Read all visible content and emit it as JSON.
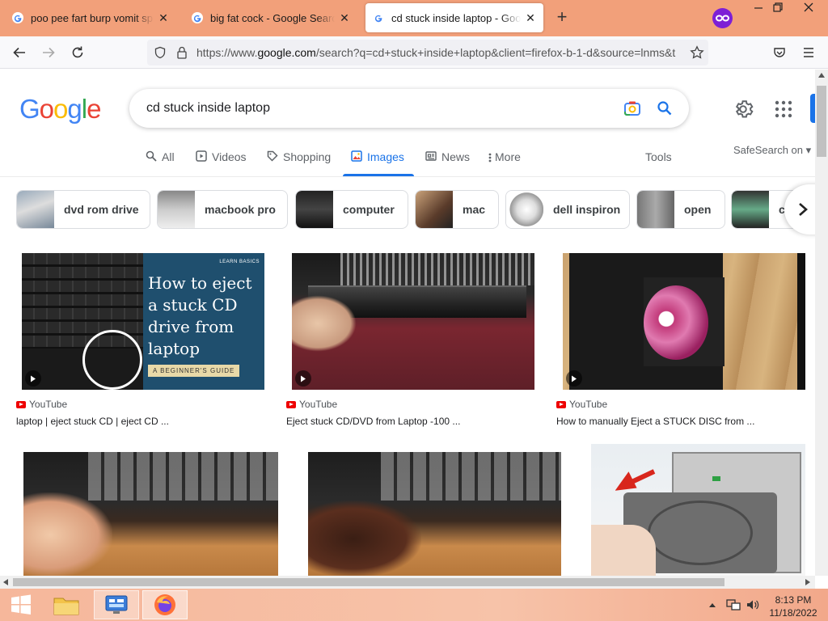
{
  "browser": {
    "tabs": [
      {
        "title": "poo pee fart burp vomit spit - G",
        "active": false
      },
      {
        "title": "big fat cock - Google Search",
        "active": false
      },
      {
        "title": "cd stuck inside laptop - Google",
        "active": true
      }
    ],
    "url_prefix": "https://www.",
    "url_domain": "google.com",
    "url_rest": "/search?q=cd+stuck+inside+laptop&client=firefox-b-1-d&source=lnms&t"
  },
  "google": {
    "logo": [
      "G",
      "o",
      "o",
      "g",
      "l",
      "e"
    ],
    "logo_colors": [
      "#4285F4",
      "#EA4335",
      "#FBBC05",
      "#4285F4",
      "#34A853",
      "#EA4335"
    ],
    "query": "cd stuck inside laptop",
    "tabs": [
      {
        "label": "All",
        "icon": "search-icon"
      },
      {
        "label": "Videos",
        "icon": "video-icon"
      },
      {
        "label": "Shopping",
        "icon": "tag-icon"
      },
      {
        "label": "Images",
        "icon": "image-icon",
        "active": true
      },
      {
        "label": "News",
        "icon": "news-icon"
      },
      {
        "label": "More",
        "icon": "more-dots-icon"
      }
    ],
    "tools": "Tools",
    "safesearch": "SafeSearch on"
  },
  "chips": [
    "dvd rom drive",
    "macbook pro",
    "computer",
    "mac",
    "dell inspiron",
    "open",
    "c"
  ],
  "results": [
    {
      "source": "YouTube",
      "title": "laptop | eject stuck CD | eject CD ...",
      "overlay_tag": "LEARN BASICS",
      "overlay_title": "How to eject a stuck CD drive from laptop",
      "overlay_sub": "A BEGINNER'S GUIDE"
    },
    {
      "source": "YouTube",
      "title": "Eject stuck CD/DVD from Laptop -100 ..."
    },
    {
      "source": "YouTube",
      "title": "How to manually Eject a STUCK DISC from ..."
    }
  ],
  "taskbar": {
    "time": "8:13 PM",
    "date": "11/18/2022"
  },
  "colors": {
    "accent": "#1a73e8",
    "tabbar": "#f2a07a",
    "youtube_red": "#ee0000"
  }
}
